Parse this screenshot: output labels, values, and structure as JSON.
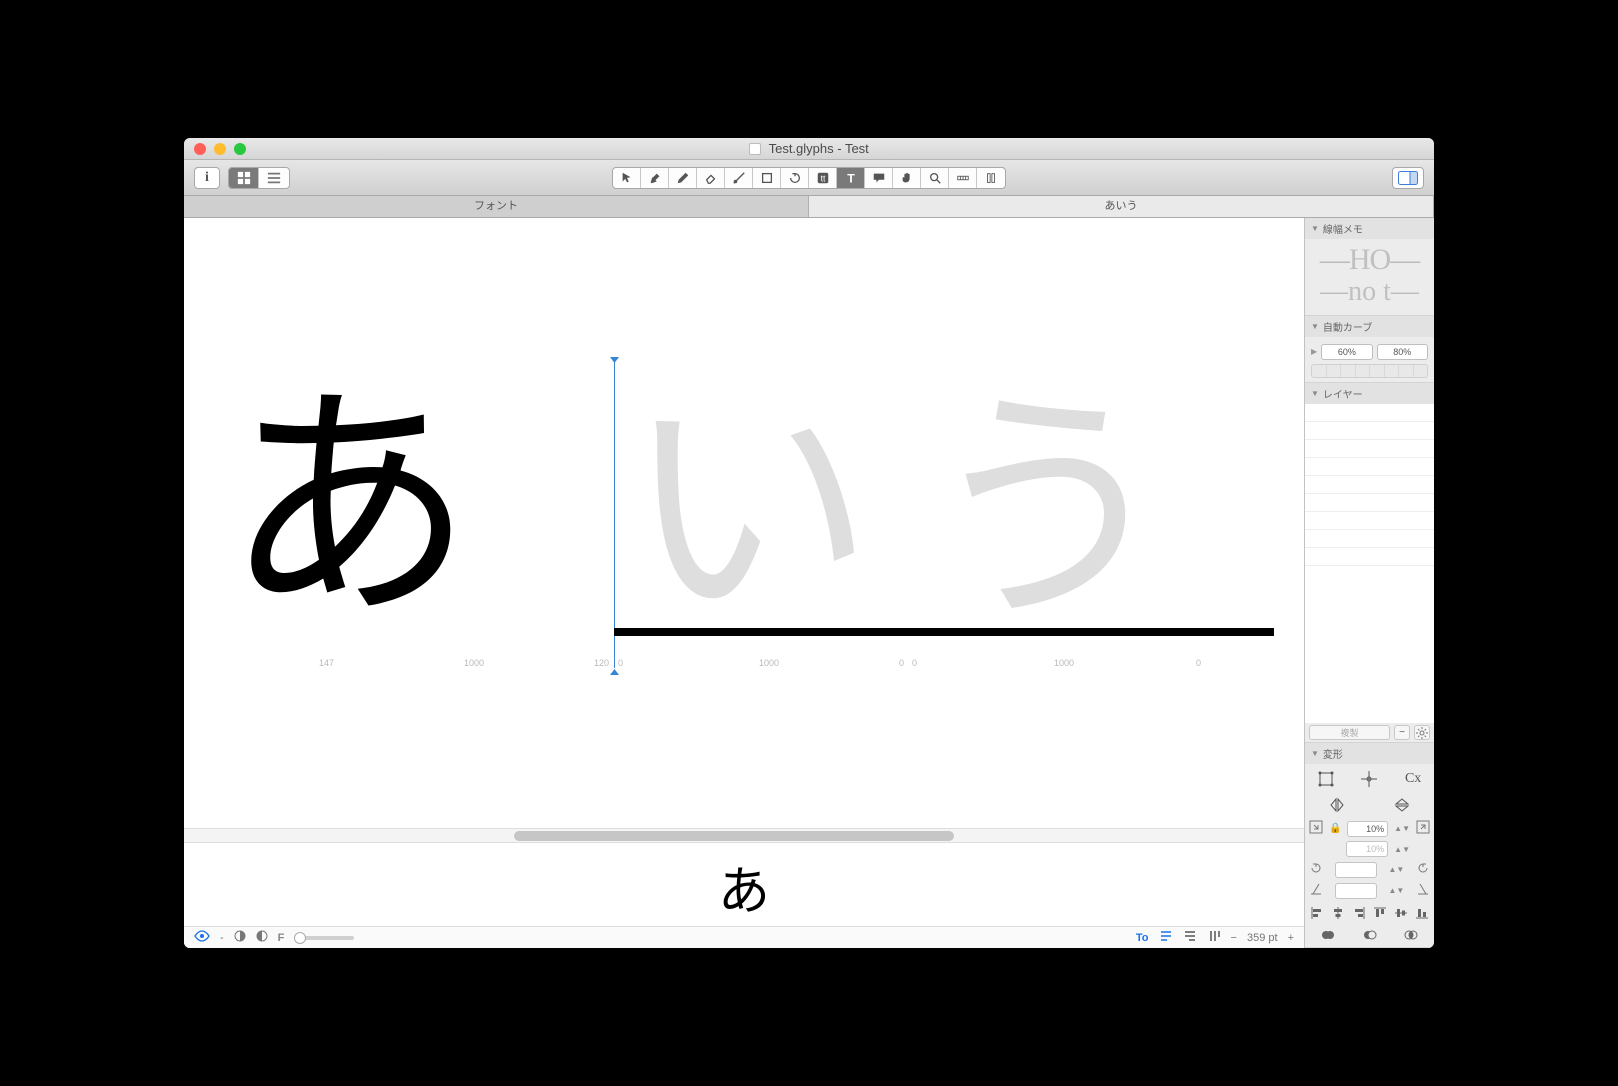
{
  "window": {
    "title": "Test.glyphs - Test"
  },
  "tabs": {
    "font": "フォント",
    "edit": "あいう"
  },
  "toolbar": {
    "info_label": "i"
  },
  "canvas": {
    "glyphs": {
      "g1": "あ",
      "g2": "い",
      "g3": "う"
    },
    "metrics": {
      "m1": "147",
      "m2": "1000",
      "m3": "120",
      "m3b": "0",
      "m4": "1000",
      "m5": "0",
      "m5b": "0",
      "m6": "1000",
      "m7": "0"
    },
    "preview": "あ"
  },
  "footer": {
    "dash": "-",
    "f_label": "F",
    "to_label": "To",
    "size_value": "359 pt"
  },
  "inspector": {
    "stroke_header": "線幅メモ",
    "stroke_sample_upper": "HO",
    "stroke_sample_lower": "no t",
    "curve_header": "自動カーブ",
    "curve_low": "60%",
    "curve_high": "80%",
    "layers_header": "レイヤー",
    "layer_copy": "複製",
    "transform_header": "変形",
    "cx_label": "Cx",
    "scale_value": "10%",
    "scale_value2": "10%"
  }
}
